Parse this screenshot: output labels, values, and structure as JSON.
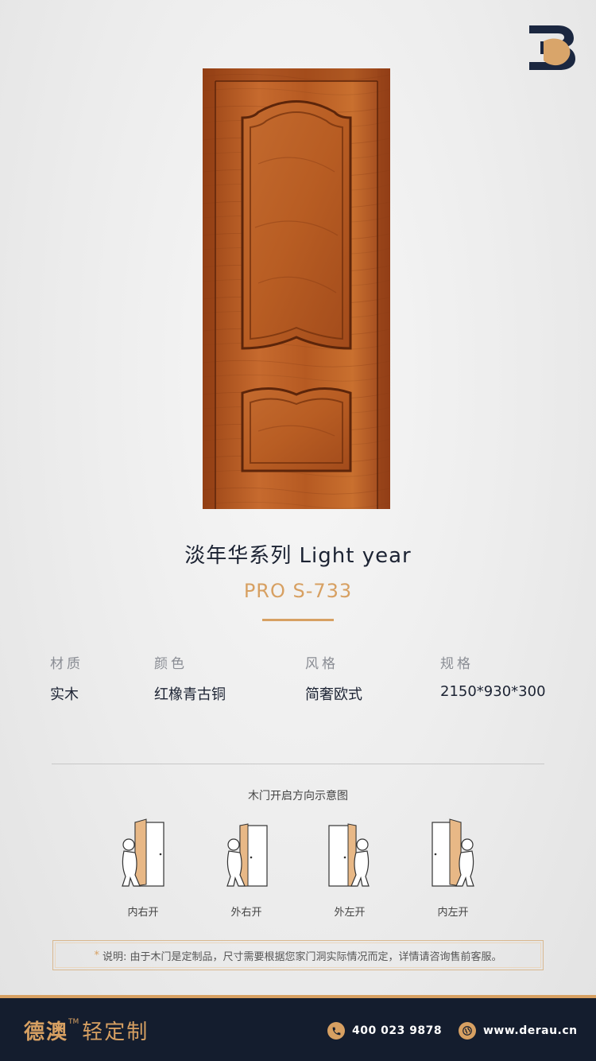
{
  "logo": {
    "icon": "brand-b-logo",
    "colors": {
      "dark": "#1b2740",
      "accent": "#d9a56a"
    }
  },
  "product": {
    "series": "淡年华系列  Light year",
    "model": "PRO S-733"
  },
  "specs": [
    {
      "label": "材质",
      "value": "实木"
    },
    {
      "label": "颜色",
      "value": "红橡青古铜"
    },
    {
      "label": "风格",
      "value": "简奢欧式"
    },
    {
      "label": "规格",
      "value": "2150*930*300"
    }
  ],
  "diagram": {
    "title": "木门开启方向示意图",
    "items": [
      {
        "label": "内右开"
      },
      {
        "label": "外右开"
      },
      {
        "label": "外左开"
      },
      {
        "label": "内左开"
      }
    ]
  },
  "note": {
    "marker": "*",
    "text": "说明: 由于木门是定制品，尺寸需要根据您家门洞实际情况而定，详情请咨询售前客服。"
  },
  "footer": {
    "brand": "德澳",
    "tm": "TM",
    "tagline": "轻定制",
    "phone": "400 023 9878",
    "website": "www.derau.cn",
    "phone_icon": "phone-icon",
    "web_icon": "globe-icon"
  },
  "colors": {
    "accent": "#d7a062",
    "navy": "#141d2e",
    "wood": "#b5571f"
  }
}
